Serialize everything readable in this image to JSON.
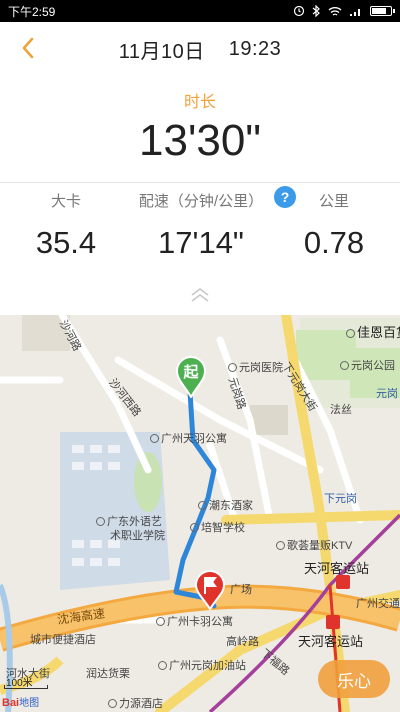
{
  "status_bar": {
    "time": "下午2:59",
    "battery_level": 0.85
  },
  "header": {
    "date": "11月10日",
    "time": "19:23"
  },
  "duration": {
    "label": "时长",
    "value": "13'30\""
  },
  "stats": [
    {
      "label": "大卡",
      "value": "35.4"
    },
    {
      "label": "配速（分钟/公里）",
      "value": "17'14\""
    },
    {
      "label": "公里",
      "value": "0.78"
    }
  ],
  "help_icon_glyph": "?",
  "map": {
    "labels": {
      "jiaen": "佳恩百货",
      "yuangang_park": "元岗公园",
      "yuangang_hospital": "元岗医院",
      "yuangang_road": "元岗路",
      "xiayuangang_street": "下元岗大街",
      "fajin": "法丝",
      "yuangang_right": "元岗",
      "tianyu": "广州天羽公寓",
      "chaodong": "潮东酒家",
      "xiayuangang": "下元岗",
      "guangwai": "广东外语艺",
      "guangwai2": "术职业学院",
      "peizhi": "培智学校",
      "gequ": "歌荟量贩KTV",
      "tianhe_top": "天河客运站",
      "guangzhou_transit": "广州交通集",
      "tianhe_bottom": "天河客运站",
      "shahe": "沙河路",
      "yuanhao": "元岗路",
      "shaxi": "沙河西路",
      "chuang": "广场",
      "tianyu2": "广州卡羽公寓",
      "shenhai": "沈海高速",
      "gaoling": "高岭路",
      "jiedai": "城市便捷酒店",
      "xiafu": "下福路",
      "hexi": "河水大街",
      "runda": "润达货栗",
      "gas": "广州元岗加油站",
      "liyuan": "力源酒店"
    },
    "scale": "100米",
    "baidu_logo": "Bai",
    "baidu_logo_suffix": "地图",
    "start_marker": "起",
    "lexin_button": "乐心"
  },
  "colors": {
    "accent": "#f0a23c",
    "route": "#2e86d8",
    "start_marker": "#4caf50",
    "end_marker": "#e0332c",
    "help": "#3b9be8"
  },
  "icons": {
    "back": "chevron-left-icon",
    "help": "question-circle-icon",
    "expand": "double-chevron-up-icon",
    "start": "start-pin-icon",
    "end": "finish-flag-icon"
  }
}
